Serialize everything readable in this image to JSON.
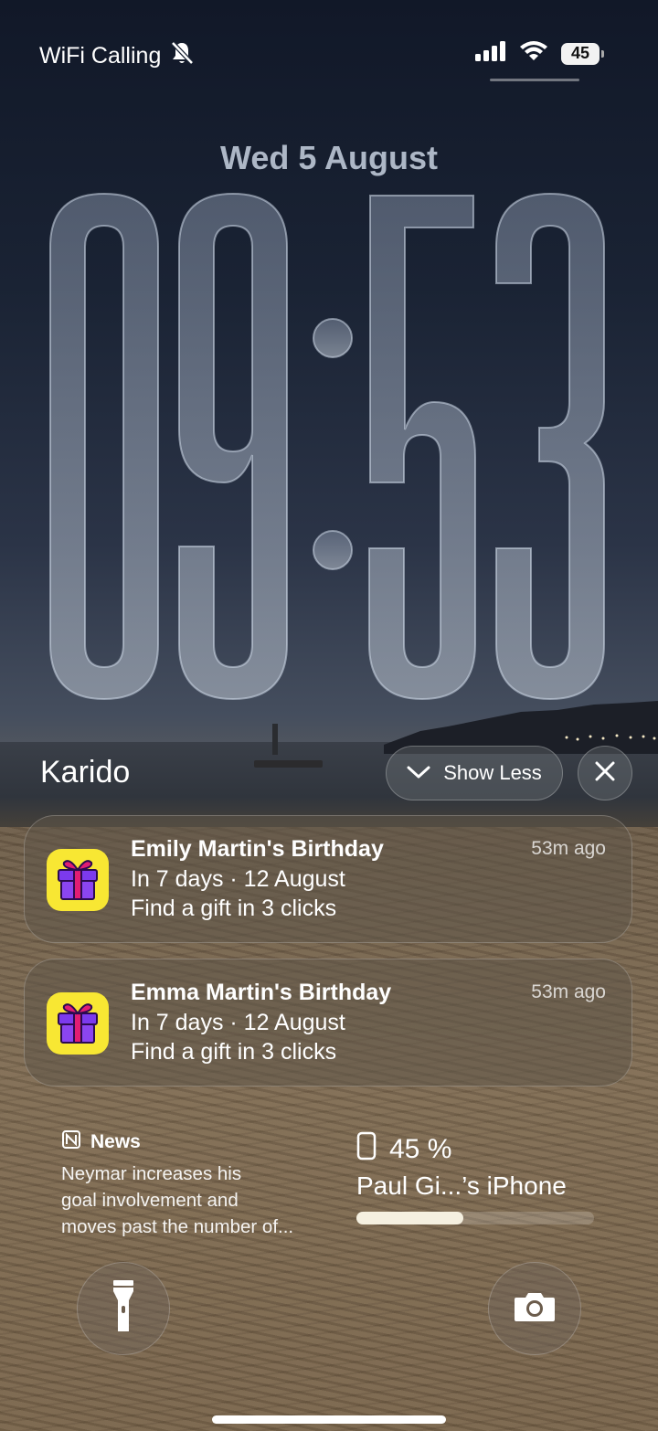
{
  "status_bar": {
    "carrier": "WiFi Calling",
    "battery_level": "45",
    "icons": [
      "bell-slash-icon",
      "signal-icon",
      "wifi-icon",
      "battery-icon"
    ]
  },
  "lock_screen": {
    "date": "Wed 5 August",
    "time": "09:53"
  },
  "notification_group": {
    "app_name": "Karido",
    "show_less_label": "Show Less",
    "notifications": [
      {
        "title": "Emily Martin's Birthday",
        "time": "53m ago",
        "line1": "In 7 days · 12 August",
        "line2": "Find a gift in 3 clicks"
      },
      {
        "title": "Emma Martin's Birthday",
        "time": "53m ago",
        "line1": "In 7 days · 12 August",
        "line2": "Find a gift in 3 clicks"
      }
    ]
  },
  "widgets": {
    "news": {
      "label": "News",
      "headline_lines": [
        "Neymar increases his",
        "goal involvement and",
        "moves past the number of..."
      ]
    },
    "battery": {
      "percent_text": "45 %",
      "device_name": "Paul Gi...’s iPhone",
      "level": 0.45
    }
  },
  "quick_actions": [
    "flashlight-icon",
    "camera-icon"
  ],
  "colors": {
    "app_icon_bg": "#f8e733",
    "gift_purple": "#7c3aed",
    "gift_ribbon": "#e11d74"
  }
}
